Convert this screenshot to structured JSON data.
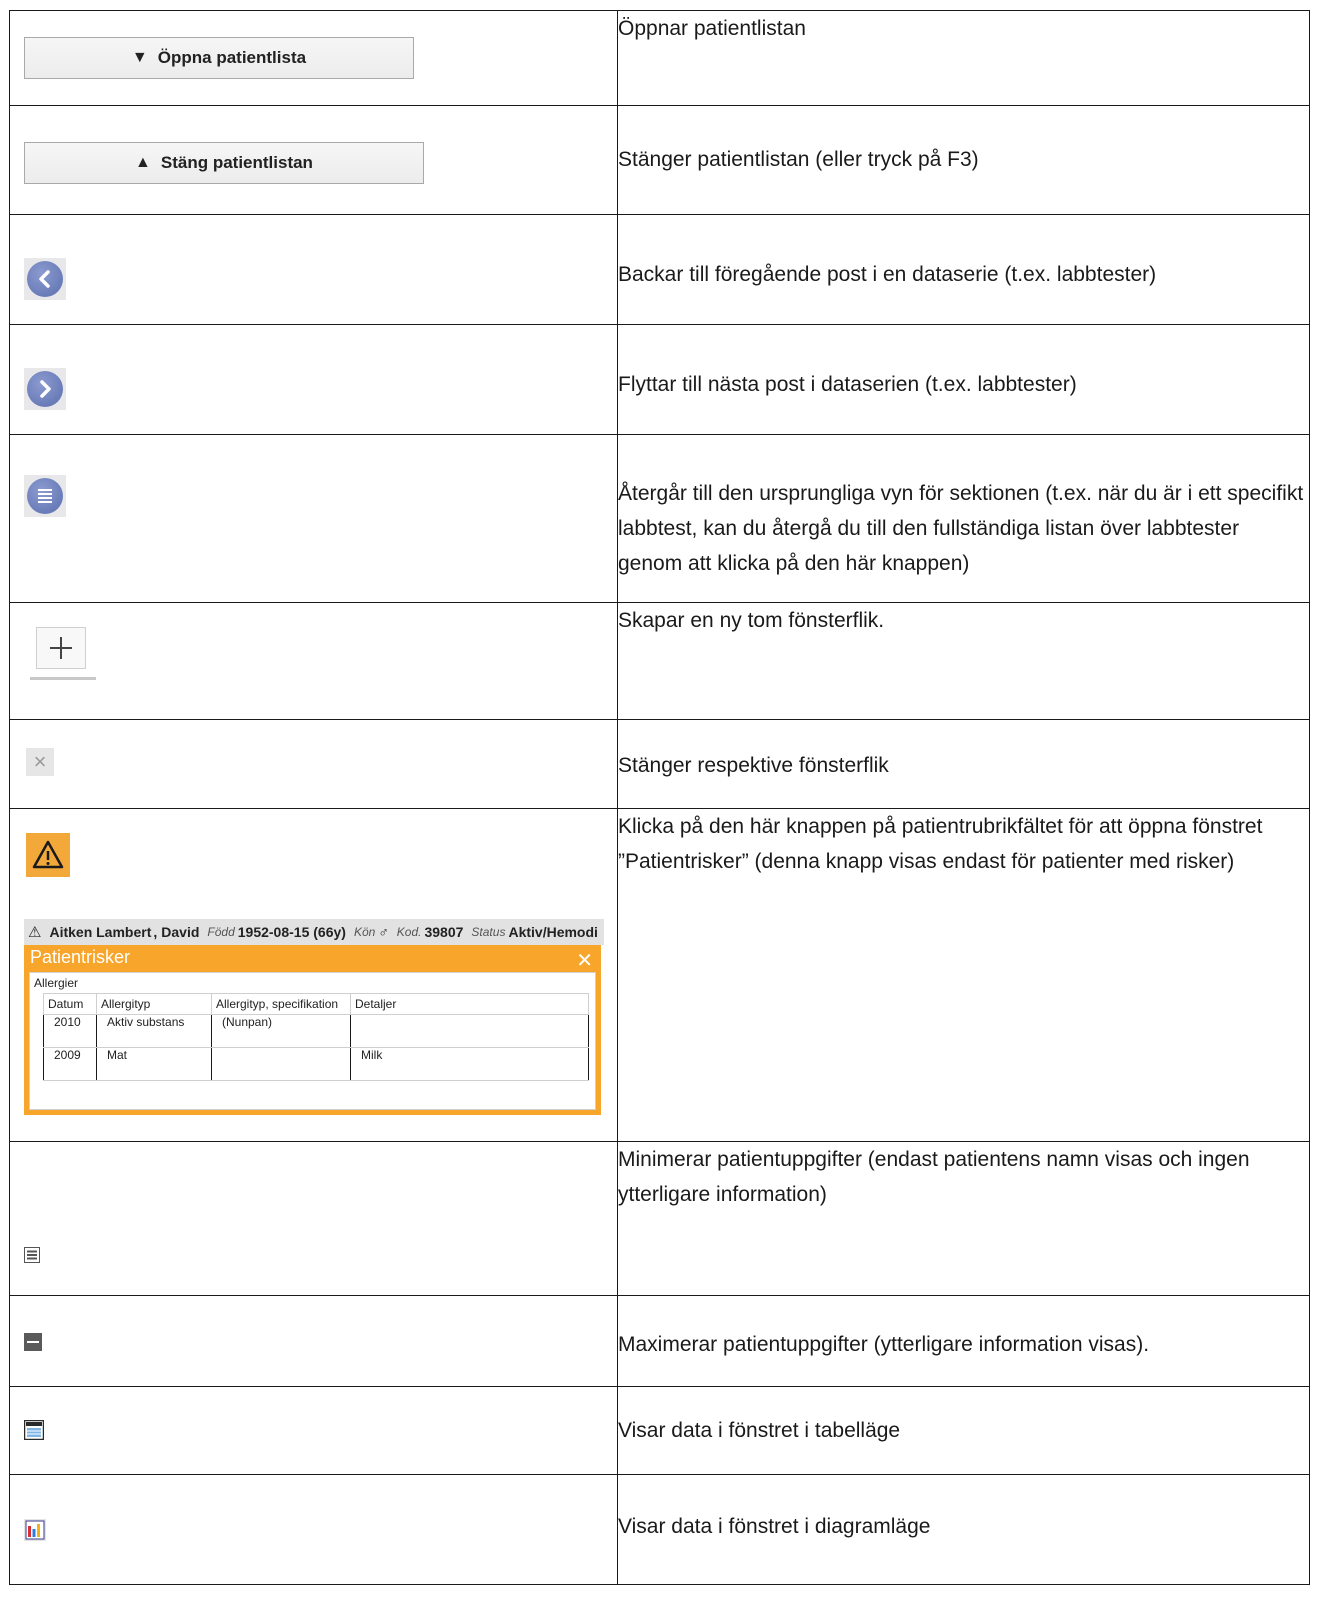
{
  "rows": [
    {
      "button_label": "Öppna patientlista",
      "button_glyph": "▼",
      "description": "Öppnar patientlistan"
    },
    {
      "button_label": "Stäng patientlistan",
      "button_glyph": "▲",
      "description": "Stänger patientlistan (eller tryck på F3)"
    },
    {
      "icon": "arrow-left-circle-icon",
      "description": "Backar till föregående post i en dataserie (t.ex. labbtester)"
    },
    {
      "icon": "arrow-right-circle-icon",
      "description": "Flyttar till nästa post i dataserien (t.ex. labbtester)"
    },
    {
      "icon": "list-circle-icon",
      "description": "Återgår till den ursprungliga vyn för sektionen (t.ex. när du är i ett specifikt labbtest, kan du återgå du till den fullständiga listan över labbtester genom att klicka på den här knappen)"
    },
    {
      "icon": "plus-icon",
      "description": "Skapar en ny tom fönsterflik."
    },
    {
      "icon": "close-x-icon",
      "description": "Stänger respektive fönsterflik"
    },
    {
      "icon": "warning-icon",
      "description": "Klicka på den här knappen på patientrubrikfältet för att öppna fönstret ”Patientrisker” (denna knapp visas endast för patienter med risker)"
    },
    {
      "icon": "minimize-lines-icon",
      "description": "Minimerar patientuppgifter (endast patientens namn visas och ingen ytterligare information)"
    },
    {
      "icon": "maximize-dash-icon",
      "description": "Maximerar patientuppgifter (ytterligare information visas)."
    },
    {
      "icon": "table-view-icon",
      "description": "Visar data i fönstret i tabelläge"
    },
    {
      "icon": "chart-view-icon",
      "description": "Visar data i fönstret i diagramläge"
    }
  ],
  "risk_example": {
    "header": {
      "warning_glyph": "⚠",
      "surname": "Aitken Lambert",
      "separator": ",",
      "firstname": "David",
      "born_label": "Född",
      "born_value": "1952-08-15 (66y)",
      "sex_label": "Kön",
      "sex_symbol": "♂",
      "code_label": "Kod.",
      "code_value": "39807",
      "status_label": "Status",
      "status_value": "Aktiv/Hemodi"
    },
    "window_title": "Patientrisker",
    "close_glyph": "✕",
    "section": "Allergier",
    "columns": [
      "Datum",
      "Allergityp",
      "Allergityp, specifikation",
      "Detaljer"
    ],
    "rows": [
      [
        "2010",
        "Aktiv substans",
        "(Nunpan)",
        ""
      ],
      [
        "2009",
        "Mat",
        "",
        "Milk"
      ]
    ]
  },
  "colors": {
    "accent_orange": "#f7a52b",
    "icon_blue": "#6b7fba",
    "border": "#1a1a1a"
  }
}
